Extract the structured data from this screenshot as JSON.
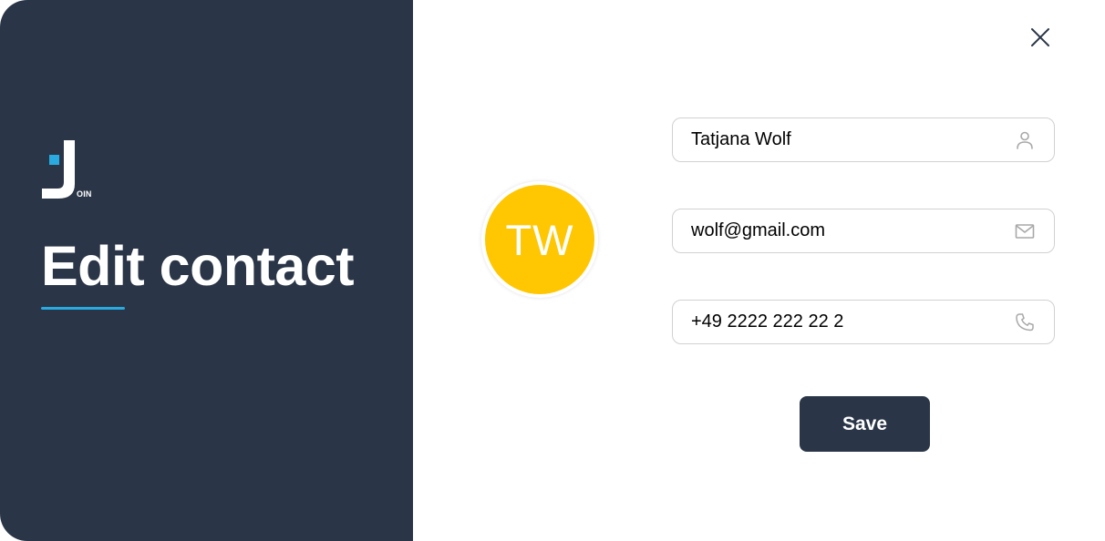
{
  "dialog": {
    "title": "Edit contact",
    "logo": {
      "text": "OIN",
      "icon": "join-logo-icon"
    },
    "close_icon": "close-icon"
  },
  "contact": {
    "initials": "TW",
    "avatar_color": "#ffc701",
    "name": "Tatjana Wolf",
    "email": "wolf@gmail.com",
    "phone": "+49 2222 222 22 2"
  },
  "fields": {
    "name_icon": "person-icon",
    "email_icon": "mail-icon",
    "phone_icon": "phone-icon"
  },
  "actions": {
    "save_label": "Save"
  },
  "colors": {
    "panel": "#2a3647",
    "accent": "#29abe2",
    "button": "#2a3647"
  }
}
